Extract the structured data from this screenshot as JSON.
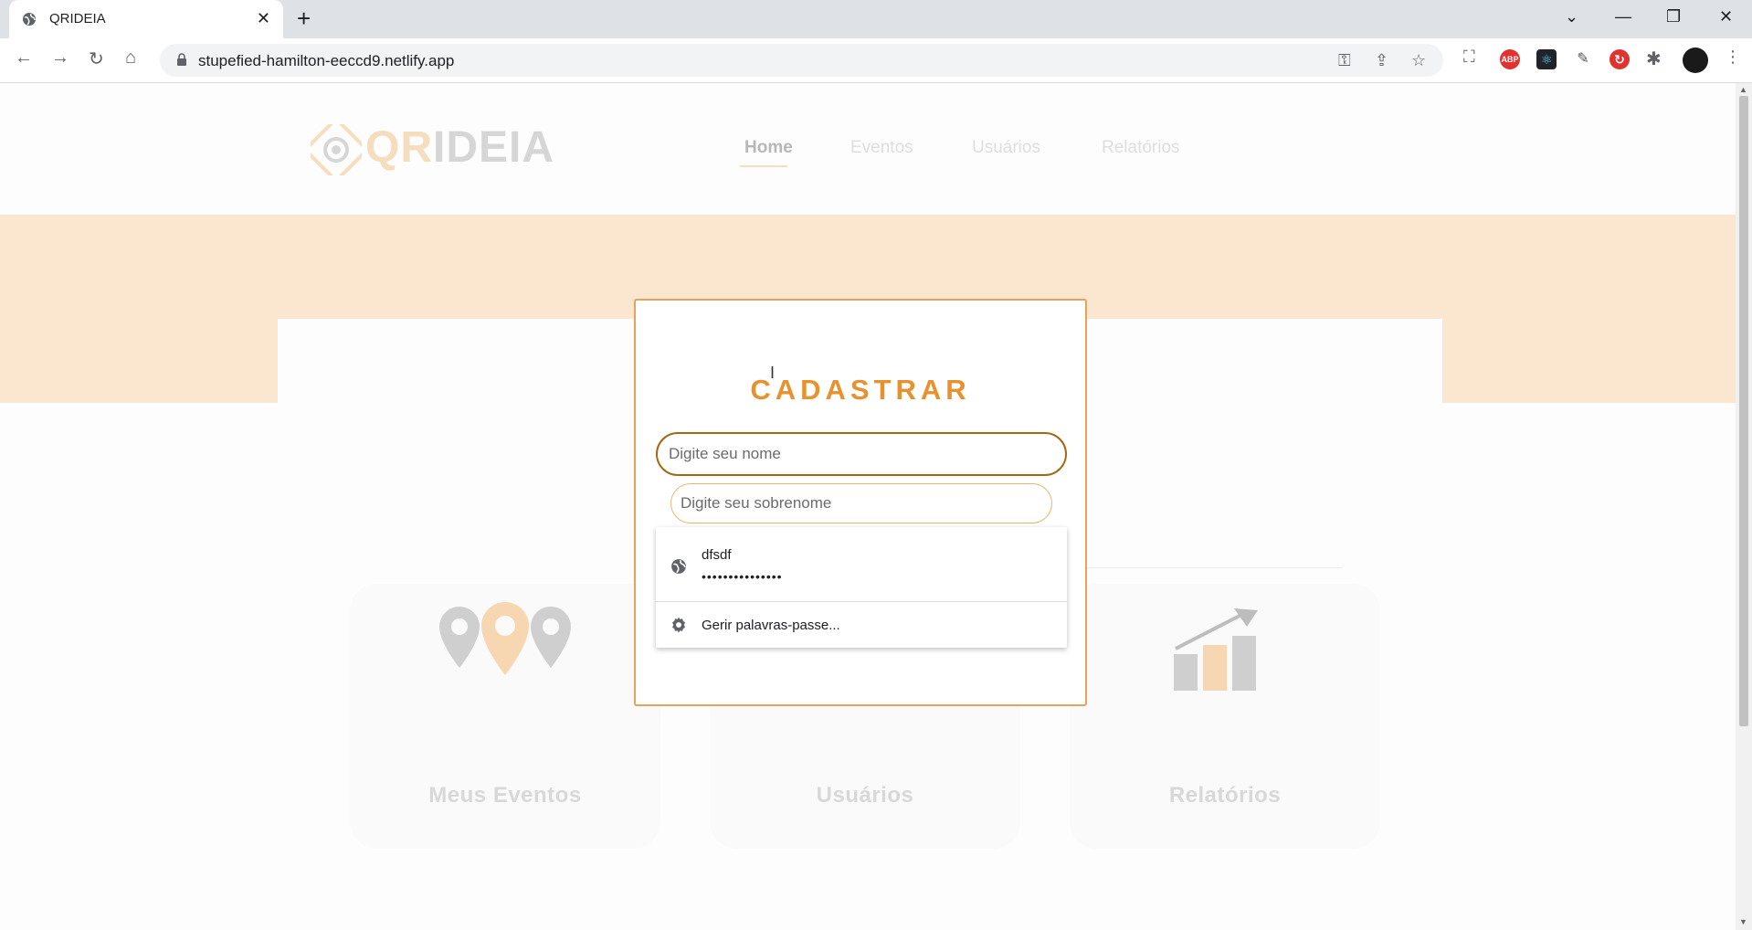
{
  "browser": {
    "tab_title": "QRIDEIA",
    "new_tab_symbol": "+",
    "tab_close_symbol": "✕",
    "url": "stupefied-hamilton-eeccd9.netlify.app",
    "window_controls": {
      "dropdown": "⌄",
      "minimize": "—",
      "restore": "❐",
      "close": "✕"
    },
    "nav": {
      "back": "←",
      "forward": "→",
      "reload": "↻",
      "home": "⌂"
    },
    "extensions": [
      {
        "name": "abp",
        "label": "ABP",
        "color": "#e0322f"
      },
      {
        "name": "react-devtools",
        "label": "⚛",
        "color": "#20232a"
      },
      {
        "name": "ext-tool",
        "label": "✎",
        "color": "#555555"
      },
      {
        "name": "ext-refresh",
        "label": "↻",
        "color": "#e0322f"
      }
    ]
  },
  "header": {
    "logo_qr": "QR",
    "logo_ideia": "IDEIA",
    "nav": [
      {
        "label": "Home",
        "active": true
      },
      {
        "label": "Eventos",
        "active": false
      },
      {
        "label": "Usuários",
        "active": false
      },
      {
        "label": "Relatórios",
        "active": false
      }
    ]
  },
  "features": [
    {
      "label": "Meus Eventos",
      "icon": "map-pins-icon"
    },
    {
      "label": "Usuários",
      "icon": "user-icon"
    },
    {
      "label": "Relatórios",
      "icon": "bar-chart-icon"
    }
  ],
  "modal": {
    "title": "CADASTRAR",
    "first_name_placeholder": "Digite seu nome",
    "last_name_placeholder": "Digite seu sobrenome"
  },
  "autofill": {
    "username": "dfsdf",
    "password_mask": "•••••••••••••••",
    "manage_label": "Gerir palavras-passe..."
  },
  "colors": {
    "accent": "#e8922f",
    "band": "#fbe6cf",
    "modal_border": "#e8a259"
  }
}
